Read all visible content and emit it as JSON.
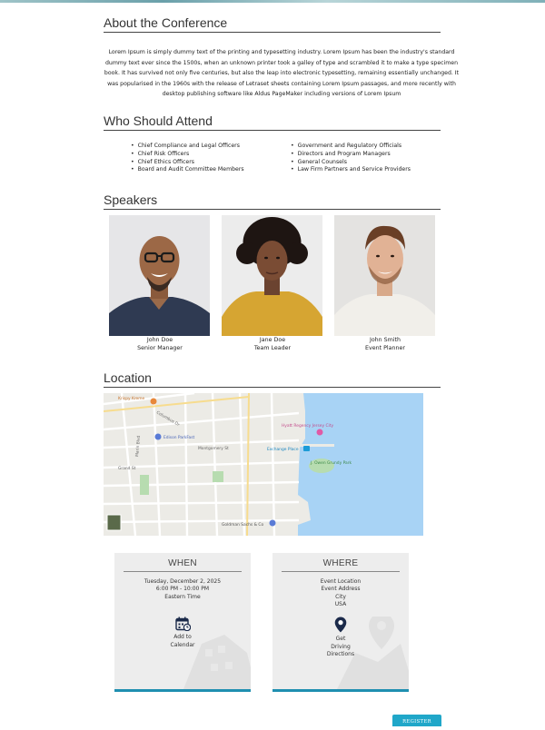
{
  "about": {
    "title": "About the Conference",
    "paragraph": "Lorem Ipsum is simply dummy text of the printing and typesetting industry. Lorem Ipsum has been the industry's standard dummy text ever since the 1500s, when an unknown printer took a galley of type and scrambled it to make a type specimen book. It has survived not only five centuries, but also the leap into electronic typesetting, remaining essentially unchanged. It was popularised in the 1960s with the release of Letraset sheets containing Lorem Ipsum passages, and more recently with desktop publishing software like Aldus PageMaker including versions of Lorem Ipsum"
  },
  "attend": {
    "title": "Who Should Attend",
    "left": [
      "Chief Compliance and Legal Officers",
      "Chief Risk Officers",
      "Chief Ethics Officers",
      "Board and Audit Committee Members"
    ],
    "right": [
      "Government and Regulatory Officials",
      "Directors and Program Managers",
      "General Counsels",
      "Law Firm Partners and Service Providers"
    ]
  },
  "speakers": {
    "title": "Speakers",
    "items": [
      {
        "name": "John Doe",
        "role": "Senior Manager"
      },
      {
        "name": "Jane Doe",
        "role": "Team Leader"
      },
      {
        "name": "John Smith",
        "role": "Event Planner"
      }
    ]
  },
  "location": {
    "title": "Location",
    "labels": {
      "krispy": "Krispy Kreme",
      "edison": "Edison ParkFast",
      "hyatt": "Hyatt Regency Jersey City",
      "exchange": "Exchange Place",
      "owen": "J. Owen Grundy Park",
      "goldman": "Goldman Sachs & Co",
      "columbus": "Columbus Dr",
      "montgomery": "Montgomery St",
      "grand": "Grand St",
      "marin": "Marin Blvd"
    }
  },
  "when": {
    "title": "WHEN",
    "date": "Tuesday, December 2, 2025",
    "time": "6:00 PM - 10:00 PM",
    "timezone": "Eastern Time",
    "action_line1": "Add to",
    "action_line2": "Calendar",
    "icon": "calendar-icon"
  },
  "where": {
    "title": "WHERE",
    "location": "Event Location",
    "address": "Event Address",
    "city": "City",
    "country": "USA",
    "action_line1": "Get",
    "action_line2": "Driving",
    "action_line3": "Directions",
    "icon": "map-pin-icon"
  },
  "register": {
    "label": "REGISTER",
    "color": "#20a7c9"
  }
}
